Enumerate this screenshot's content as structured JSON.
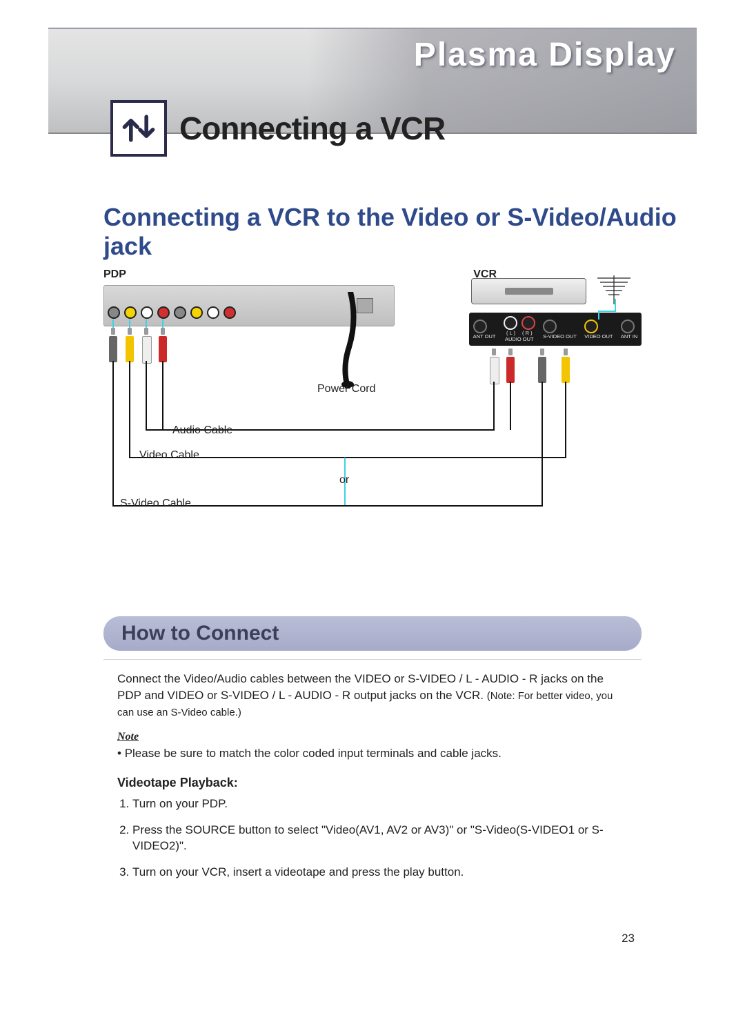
{
  "banner": {
    "brand": "Plasma Display"
  },
  "page_title": "Connecting a VCR",
  "section_title": "Connecting a VCR to the Video or S-Video/Audio jack",
  "diagram": {
    "label_pdp": "PDP",
    "label_vcr": "VCR",
    "power_cord": "Power Cord",
    "audio_cable": "Audio Cable",
    "video_cable": "Video Cable",
    "or": "or",
    "svideo_cable": "S-Video Cable",
    "vcr_ports": {
      "ant_out": "ANT OUT",
      "audio_l": "( L )",
      "audio_r": "( R )",
      "audio_out": "AUDIO OUT",
      "svideo_out": "S-VIDEO OUT",
      "video_out": "VIDEO OUT",
      "ant_in": "ANT IN"
    }
  },
  "howto": {
    "heading": "How to Connect",
    "para1a": "Connect the Video/Audio cables between the VIDEO or S-VIDEO / L - AUDIO - R jacks on the PDP and VIDEO or S-VIDEO / L - AUDIO - R output jacks on the VCR. ",
    "para1b": "(Note: For better video, you can use an S-Video cable.)",
    "note_label": "Note",
    "note_bullet": "Please be sure to match the color coded input terminals and cable jacks.",
    "playback_heading": "Videotape Playback:",
    "steps": [
      "Turn on your PDP.",
      "Press the SOURCE button to select \"Video(AV1, AV2 or AV3)\" or \"S-Video(S-VIDEO1 or S-VIDEO2)\".",
      "Turn on your VCR, insert a videotape and press the play button."
    ]
  },
  "page_number": "23"
}
